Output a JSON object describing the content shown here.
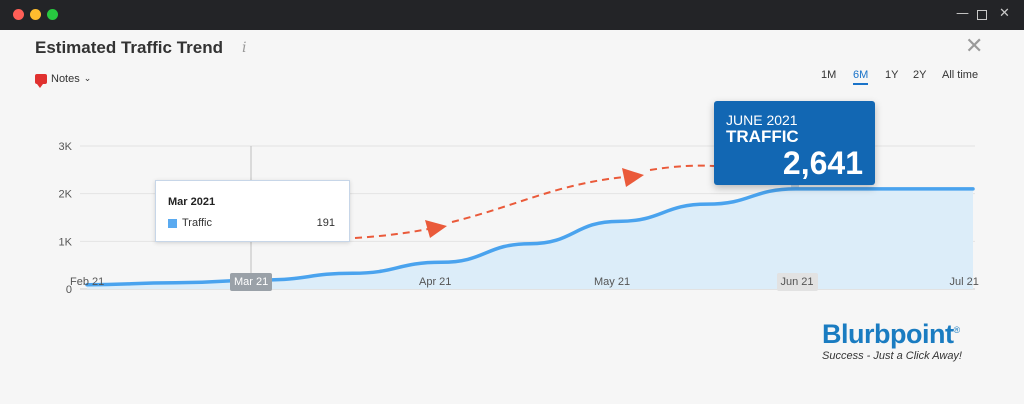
{
  "window": {
    "minimize": "—",
    "close": "✕"
  },
  "title": "Estimated Traffic Trend",
  "info_icon": "i",
  "close_icon": "✕",
  "notes": {
    "label": "Notes",
    "chevron": "⌄"
  },
  "ranges": [
    {
      "label": "1M",
      "active": false
    },
    {
      "label": "6M",
      "active": true
    },
    {
      "label": "1Y",
      "active": false
    },
    {
      "label": "2Y",
      "active": false
    },
    {
      "label": "All time",
      "active": false
    }
  ],
  "tooltip": {
    "date": "Mar 2021",
    "series": "Traffic",
    "value": "191"
  },
  "callout": {
    "month": "JUNE 2021",
    "label": "TRAFFIC",
    "value": "2,641"
  },
  "logo": {
    "word": "Blurbpoint",
    "reg": "®",
    "tagline": "Success - Just a Click Away!"
  },
  "colors": {
    "line": "#4aa3ee",
    "area": "#dcedf9",
    "callout": "#1267b3",
    "arrow": "#ea5a3a"
  },
  "chart_data": {
    "type": "area",
    "x": [
      "Feb 21",
      "Feb 21 +2w",
      "Mar 21",
      "Mar 21 +2w",
      "Apr 21",
      "Apr 21 +2w",
      "May 21",
      "May 21 +2w",
      "Jun 21",
      "Jun 21 +2w",
      "Jul 21"
    ],
    "x_ticks": [
      "Feb 21",
      "Mar 21",
      "Apr 21",
      "May 21",
      "Jun 21",
      "Jul 21"
    ],
    "highlighted_ticks": [
      "Mar 21",
      "Jun 21"
    ],
    "y_ticks": [
      "0",
      "1K",
      "2K",
      "3K"
    ],
    "ylim": [
      0,
      3000
    ],
    "series": [
      {
        "name": "Traffic",
        "values": [
          90,
          130,
          191,
          330,
          560,
          950,
          1420,
          1780,
          2100,
          2100,
          2100
        ]
      }
    ],
    "grid": true
  }
}
